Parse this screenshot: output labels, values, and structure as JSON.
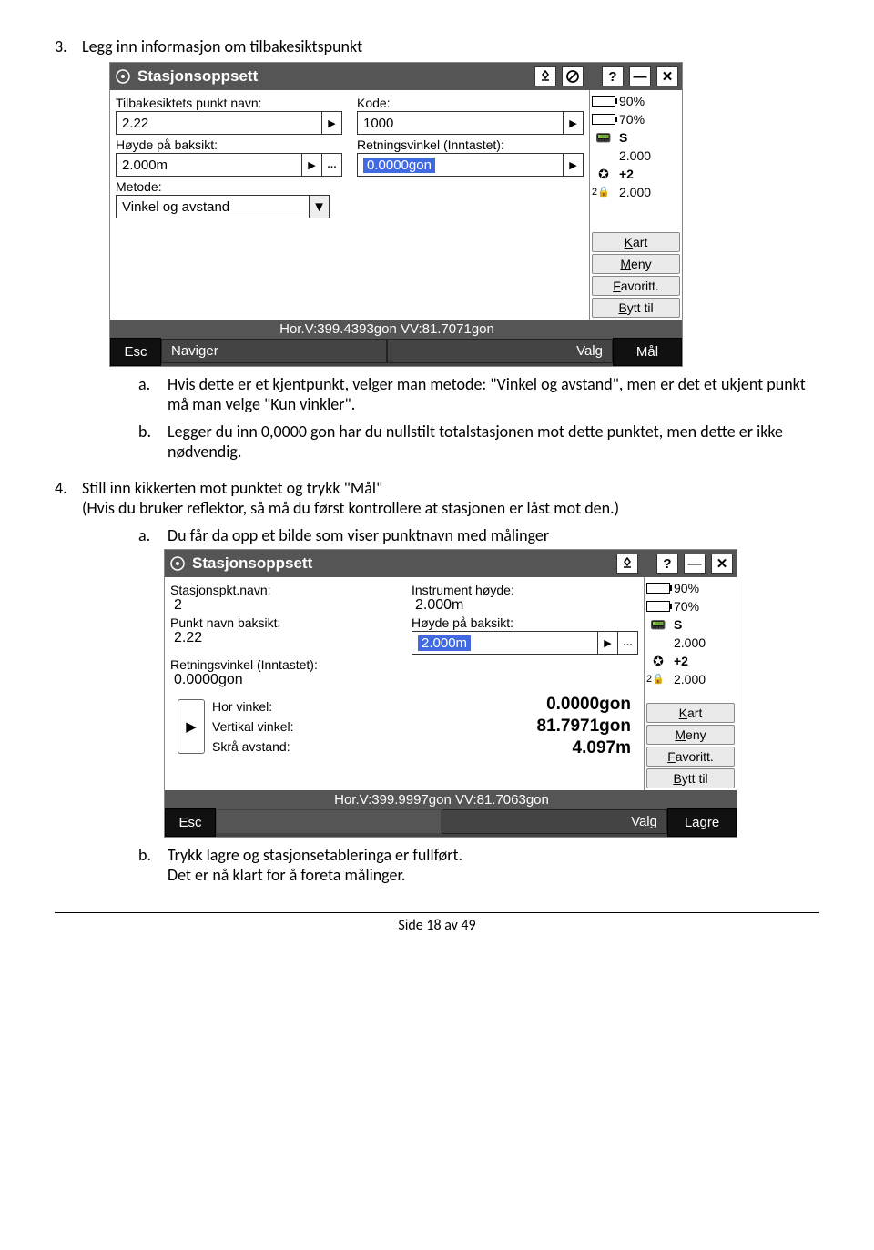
{
  "steps": {
    "s3": {
      "num": "3.",
      "text": "Legg inn informasjon om tilbakesiktspunkt"
    },
    "s3a": {
      "letter": "a.",
      "text": "Hvis dette er et kjentpunkt, velger man metode: \"Vinkel og avstand\", men er det et ukjent punkt må man velge \"Kun vinkler\"."
    },
    "s3b": {
      "letter": "b.",
      "text": "Legger du inn 0,0000 gon har du nullstilt totalstasjonen mot dette punktet, men dette er ikke nødvendig."
    },
    "s4": {
      "num": "4.",
      "text": "Still inn kikkerten mot punktet og trykk \"Mål\"",
      "sub": "(Hvis du bruker reflektor, så må du først kontrollere at stasjonen er låst mot den.)"
    },
    "s4a": {
      "letter": "a.",
      "text": "Du får da opp et bilde som viser punktnavn med målinger"
    },
    "s4b": {
      "letter": "b.",
      "text": "Trykk lagre og stasjonsetableringa er fullført.",
      "sub": "Det er nå klart for å foreta målinger."
    }
  },
  "shot1": {
    "title": "Stasjonsoppsett",
    "labels": {
      "tilbakesikt": "Tilbakesiktets punkt navn:",
      "kode": "Kode:",
      "hoyde_bak": "Høyde på baksikt:",
      "retning": "Retningsvinkel (Inntastet):",
      "metode": "Metode:"
    },
    "values": {
      "tilbakesikt": "2.22",
      "kode": "1000",
      "hoyde_bak": "2.000m",
      "retning": "0.0000gon",
      "metode": "Vinkel og avstand"
    },
    "status": "Hor.V:399.4393gon  VV:81.7071gon",
    "softkeys": {
      "esc": "Esc",
      "naviger": "Naviger",
      "valg": "Valg",
      "maal": "Mål"
    }
  },
  "shot2": {
    "title": "Stasjonsoppsett",
    "labels": {
      "stasjon_navn": "Stasjonspkt.navn:",
      "instr_hoyde": "Instrument høyde:",
      "punkt_bak": "Punkt navn baksikt:",
      "hoyde_bak": "Høyde på baksikt:",
      "retning": "Retningsvinkel (Inntastet):"
    },
    "values": {
      "stasjon_navn": "2",
      "instr_hoyde": "2.000m",
      "punkt_bak": "2.22",
      "hoyde_bak": "2.000m",
      "retning": "0.0000gon"
    },
    "meas": {
      "hv_lbl": "Hor vinkel:",
      "vv_lbl": "Vertikal vinkel:",
      "sa_lbl": "Skrå avstand:",
      "hv": "0.0000gon",
      "vv": "81.7971gon",
      "sa": "4.097m"
    },
    "status": "Hor.V:399.9997gon  VV:81.7063gon",
    "softkeys": {
      "esc": "Esc",
      "valg": "Valg",
      "lagre": "Lagre"
    }
  },
  "side": {
    "batt1": "90%",
    "batt2": "70%",
    "s": "S",
    "v1": "2.000",
    "plus2": "+2",
    "v2": "2.000",
    "kart": "Kart",
    "meny": "Meny",
    "fav": "Favoritt.",
    "bytt": "Bytt til"
  },
  "footer": "Side 18 av 49"
}
